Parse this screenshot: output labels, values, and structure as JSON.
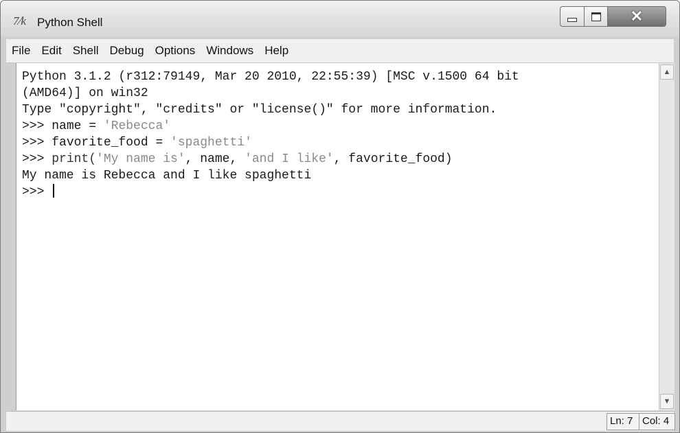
{
  "window": {
    "title": "Python Shell",
    "app_icon_glyph": "7⁄k"
  },
  "menubar": {
    "items": [
      "File",
      "Edit",
      "Shell",
      "Debug",
      "Options",
      "Windows",
      "Help"
    ]
  },
  "shell": {
    "banner_line1": "Python 3.1.2 (r312:79149, Mar 20 2010, 22:55:39) [MSC v.1500 64 bit",
    "banner_line2": "(AMD64)] on win32",
    "banner_line3": "Type \"copyright\", \"credits\" or \"license()\" for more information.",
    "lines": {
      "l4": {
        "prompt": ">>> ",
        "code": "name = ",
        "str": "'Rebecca'"
      },
      "l5": {
        "prompt": ">>> ",
        "code": "favorite_food = ",
        "str": "'spaghetti'"
      },
      "l6": {
        "prompt": ">>> ",
        "c1": "print(",
        "s1": "'My name is'",
        "c2": ", name, ",
        "s2": "'and I like'",
        "c3": ", favorite_food)"
      },
      "l7": {
        "output": "My name is Rebecca and I like spaghetti"
      },
      "l8": {
        "prompt": ">>> "
      }
    }
  },
  "status": {
    "ln": "Ln: 7",
    "col": "Col: 4"
  }
}
